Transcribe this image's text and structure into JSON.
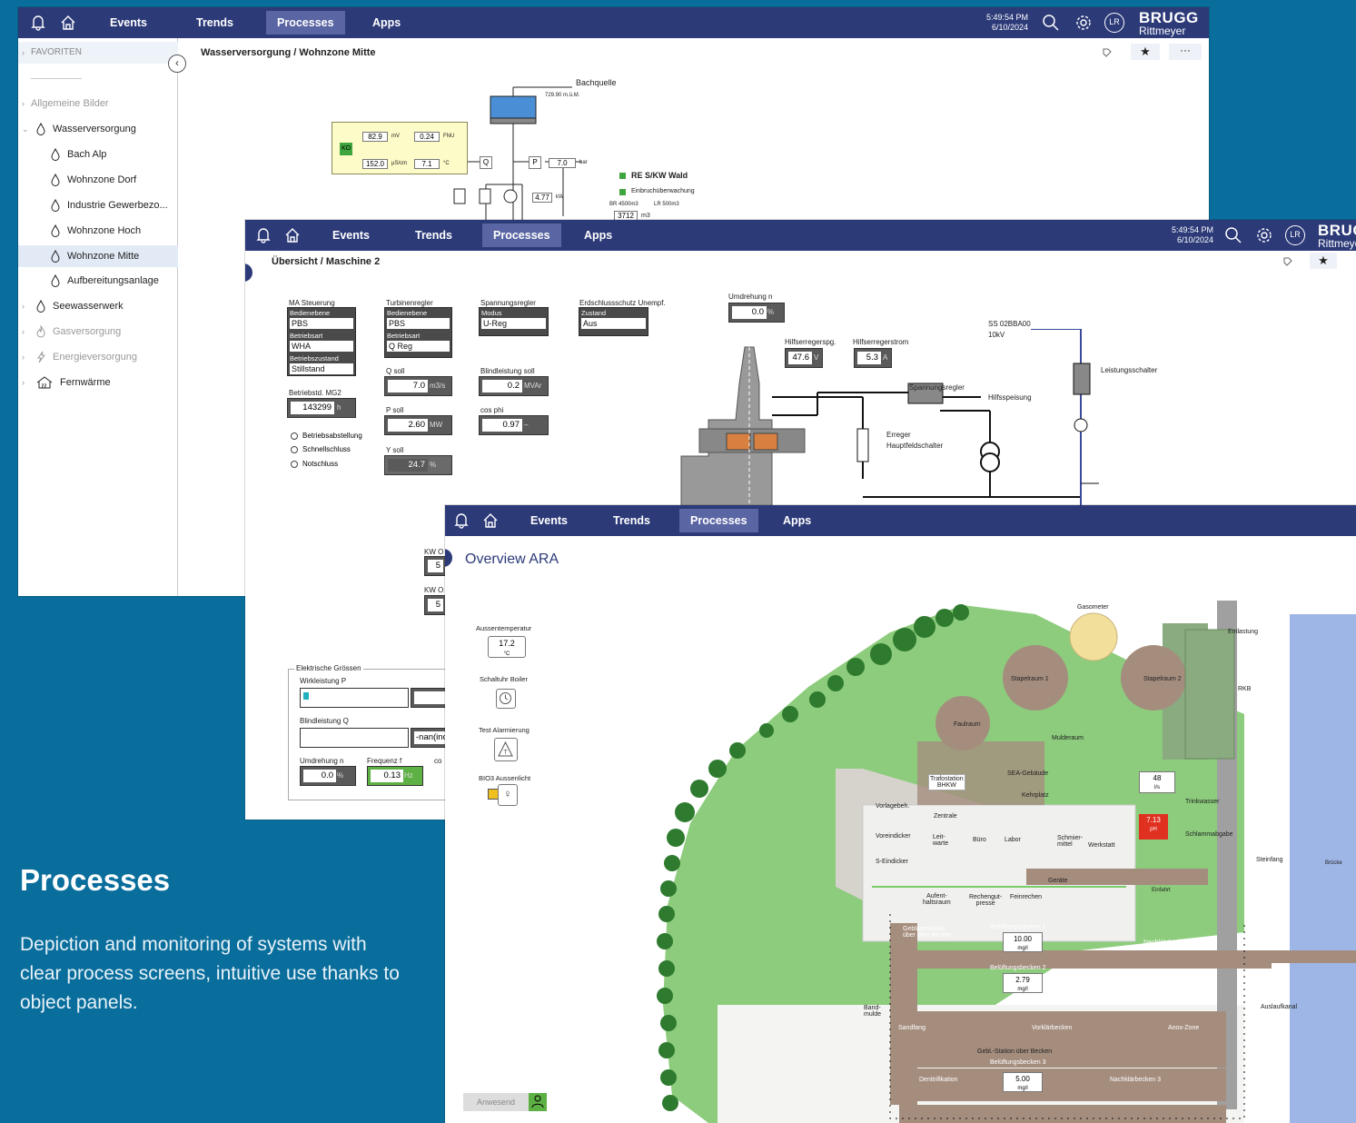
{
  "nav": {
    "events": "Events",
    "trends": "Trends",
    "processes": "Processes",
    "apps": "Apps"
  },
  "status": {
    "time": "5:49:54 PM",
    "date": "6/10/2024",
    "user_initials": "LR"
  },
  "brand": {
    "line1": "BRUGG",
    "line2": "Rittmeyer"
  },
  "win1": {
    "breadcrumb": [
      "Wasserversorgung",
      "Wohnzone Mitte"
    ],
    "sidebar": {
      "favorites": "FAVORITEN",
      "items": [
        {
          "label": "Allgemeine Bilder",
          "level": 0
        },
        {
          "label": "Wasserversorgung",
          "level": 0
        },
        {
          "label": "Bach Alp",
          "level": 1
        },
        {
          "label": "Wohnzone Dorf",
          "level": 1
        },
        {
          "label": "Industrie Gewerbezo...",
          "level": 1
        },
        {
          "label": "Wohnzone Hoch",
          "level": 1
        },
        {
          "label": "Wohnzone Mitte",
          "level": 1
        },
        {
          "label": "Aufbereitungsanlage",
          "level": 1
        },
        {
          "label": "Seewasserwerk",
          "level": 0
        },
        {
          "label": "Gasversorgung",
          "level": 0
        },
        {
          "label": "Energieversorgung",
          "level": 0
        },
        {
          "label": "Fernwärme",
          "level": 0
        }
      ]
    },
    "diagram": {
      "bachquelle": "Bachquelle",
      "level": "729.90 m.ü.M.",
      "sensors": {
        "mv": "82.9",
        "mv_unit": "mV",
        "fnu": "0.24",
        "fnu_unit": "FNU",
        "cond": "152.0",
        "cond_unit": "µS/cm",
        "temp": "7.1",
        "temp_unit": "°C"
      },
      "q_label": "Q",
      "p_label": "P",
      "pressure": "7.0",
      "pressure_unit": "bar",
      "power": "4.77",
      "power_unit": "kW",
      "legend1": "RE S/KW Wald",
      "legend2": "Einbruchüberwachung",
      "br": "BR 4500m3",
      "lr": "LR 500m3",
      "volume": "3712",
      "volume_unit": "m3"
    }
  },
  "win2": {
    "breadcrumb": [
      "Übersicht",
      "Maschine 2"
    ],
    "ma_steuerung": {
      "title": "MA Steuerung",
      "f1_label": "Bedienebene",
      "f1_value": "PBS",
      "f2_label": "Betriebsart",
      "f2_value": "WHA",
      "f3_label": "Betriebszustand",
      "f3_value": "Stillstand"
    },
    "turbinenregler": {
      "title": "Turbinenregler",
      "f1_label": "Bedienebene",
      "f1_value": "PBS",
      "f2_label": "Betriebsart",
      "f2_value": "Q Reg"
    },
    "spannungsregler": {
      "title": "Spannungsregler",
      "f1_label": "Modus",
      "f1_value": "U-Reg"
    },
    "erdschluss": {
      "title": "Erdschlussschutz Unempf.",
      "f1_label": "Zustand",
      "f1_value": "Aus"
    },
    "betriebsstd": {
      "label": "Betriebstd. MG2",
      "value": "143299",
      "unit": "h"
    },
    "radios": [
      "Betriebsabstellung",
      "Schnellschluss",
      "Notschluss"
    ],
    "q_soll": {
      "label": "Q soll",
      "value": "7.0",
      "unit": "m3/s"
    },
    "p_soll": {
      "label": "P soll",
      "value": "2.60",
      "unit": "MW"
    },
    "y_soll": {
      "label": "Y soll",
      "value": "24.7",
      "unit": "%"
    },
    "blind_soll": {
      "label": "Blindleistung soll",
      "value": "0.2",
      "unit": "MVAr"
    },
    "cos_phi": {
      "label": "cos phi",
      "value": "0.97",
      "unit": "–"
    },
    "umdrehung": {
      "label": "Umdrehung n",
      "value": "0.0",
      "unit": "%"
    },
    "hilfsspg": {
      "label": "Hilfserregerspg.",
      "value": "47.6",
      "unit": "V"
    },
    "hilfsstrom": {
      "label": "Hilfserregerstrom",
      "value": "5.3",
      "unit": "A"
    },
    "ss": {
      "line1": "SS 02BBA00",
      "line2": "10kV"
    },
    "leistungsschalter": "Leistungsschalter",
    "spannungsregler_lbl": "Spannungsregler",
    "hilfsspeisung": "Hilfsspeisung",
    "erreger": "Erreger",
    "hauptfeld": "Hauptfeldschalter",
    "kw1": "KW O",
    "kw1_val": "5",
    "kw2": "KW O",
    "kw2_val": "5",
    "elektrische": {
      "title": "Elektrische Grössen",
      "wirk_label": "Wirkleistung P",
      "wirk_val": "0.0",
      "blind_label": "Blindleistung Q",
      "blind_val": "-nan(ind",
      "umdr_label": "Umdrehung n",
      "umdr_val": "0.0",
      "umdr_unit": "%",
      "freq_label": "Frequenz f",
      "freq_val": "0.13",
      "freq_unit": "Hz",
      "co_label": "co"
    }
  },
  "win3": {
    "title": "Overview ARA",
    "widgets": {
      "aussen_label": "Aussentemperatur",
      "aussen_val": "17.2",
      "aussen_unit": "°C",
      "boiler_label": "Schaltuhr Boiler",
      "alarm_label": "Test Alarmierung",
      "bio_label": "BIO3 Aussenlicht"
    },
    "anwesend": "Anwesend",
    "map": {
      "gasometer": "Gasometer",
      "stapel1": "Stapelraum 1",
      "stapel2": "Stapelraum 2",
      "faulraum": "Faulraum",
      "mulderaum": "Mulderaum",
      "sea": "SEA-Gebäude",
      "trafo": "Trafostation",
      "bhkw": "BHKW",
      "kehrplatz": "Kehrplatz",
      "flow_val": "48",
      "flow_unit": "l/s",
      "vorlage": "Vorlagebeh.",
      "zentrale": "Zentrale",
      "voreindicker": "Voreindicker",
      "leitwarte": "Leit-warte",
      "buero": "Büro",
      "labor": "Labor",
      "schmier": "Schmier-mittel",
      "werkstatt": "Werkstatt",
      "seindicker": "S-Eindicker",
      "geraete": "Geräte",
      "ph_val": "7.13",
      "ph_unit": "pH",
      "trinkwasser": "Trinkwasser",
      "schlamm": "Schlammabgabe",
      "steinfang": "Steinfang",
      "einfahrt": "Einfahrt",
      "aufent1": "Aufent-",
      "aufent2": "haltsraum",
      "rechen1": "Rechengut-",
      "rechen2": "presse",
      "feinrechen": "Feinrechen",
      "geblaese1": "Gebläsestation",
      "geblaese2": "über dem Becken",
      "belueft1": "Belüftungsbecken 1",
      "b1_val": "10.00",
      "b1_unit": "mg/l",
      "belueft2": "Belüftungsbecken 2",
      "b2_val": "2.79",
      "b2_unit": "mg/l",
      "nach1": "Nachklärbecken 1",
      "nach2": "Nachklärbecken 2",
      "band1": "Band-",
      "band2": "mulde",
      "sandfang": "Sandfang",
      "vorklaer": "Vorklärbecken",
      "anox": "Anox-Zone",
      "geblstation": "Gebl.-Station über Becken",
      "belueft3": "Belüftungsbecken 3",
      "b3_val": "5.00",
      "b3_unit": "mg/l",
      "denitri": "Denitrifikation",
      "nach3": "Nachklärbecken 3",
      "entlastung": "Entlastung",
      "rkb": "RKB",
      "bruecke": "Brücke",
      "auslauf": "Auslaufkanal"
    }
  },
  "marketing": {
    "headline": "Processes",
    "description": "Depiction and monitoring of systems with clear process screens, intuitive use thanks to object panels."
  },
  "colors": {
    "background": "#0a6e9c",
    "topbar": "#2c3a78",
    "active_tab": "#5a66a4",
    "grass": "#8ccc7c",
    "building": "#a58d7e",
    "alarm": "#e03020",
    "good": "#5db043"
  }
}
